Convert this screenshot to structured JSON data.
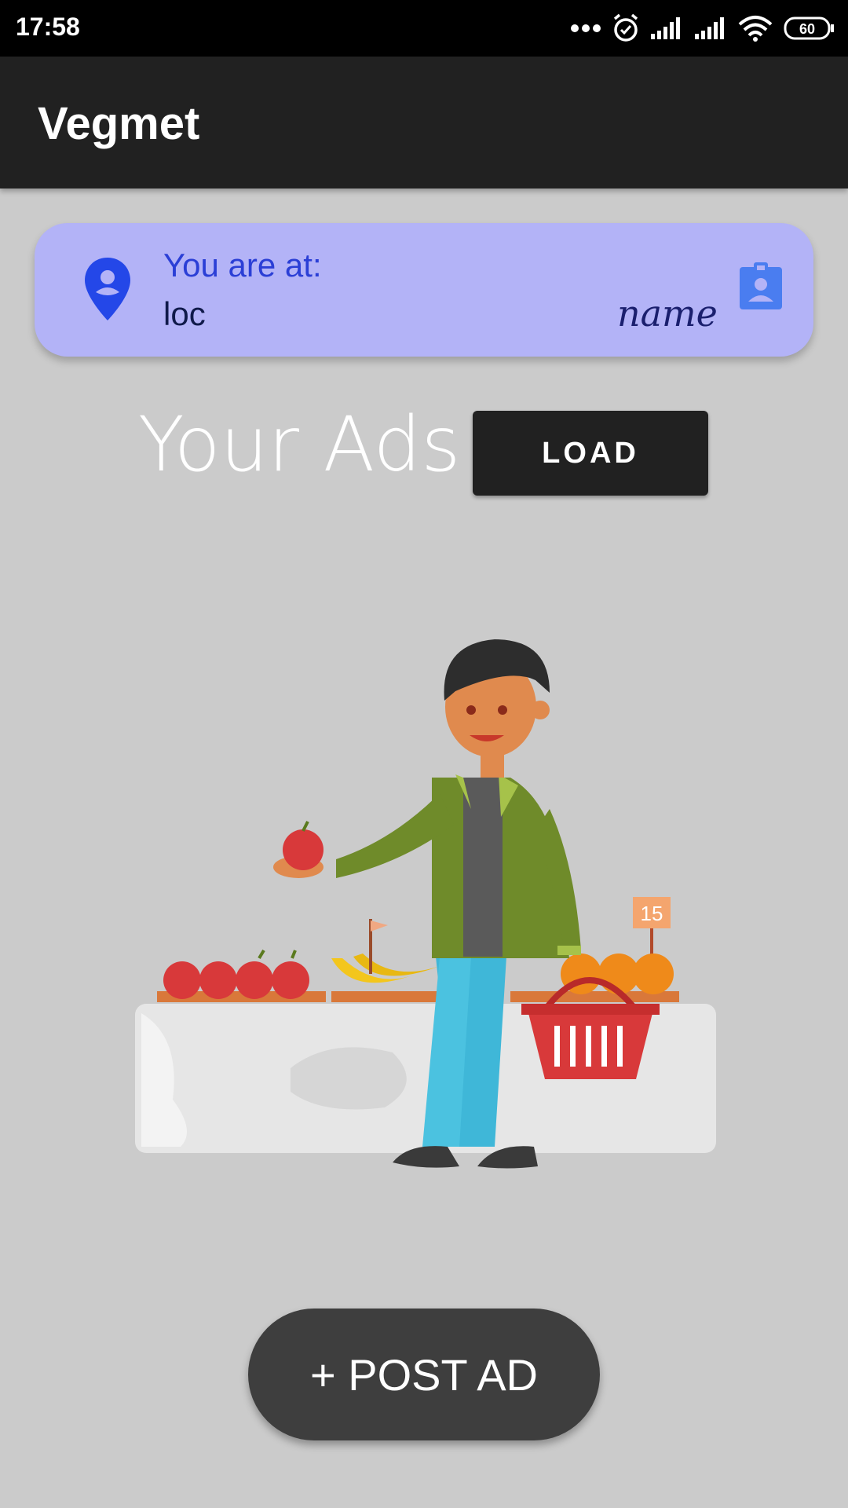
{
  "status_bar": {
    "time": "17:58",
    "battery": "60",
    "icons": [
      "more-dots-icon",
      "alarm-icon",
      "signal-icon",
      "signal-icon",
      "wifi-icon",
      "battery-icon"
    ]
  },
  "app_bar": {
    "title": "Vegmet"
  },
  "location_card": {
    "heading": "You are at:",
    "location": "loc",
    "name": "name",
    "colors": {
      "background": "#b3b3f7",
      "accent": "#2b3fd6"
    }
  },
  "ads": {
    "title": "Your Ads",
    "load_label": "LOAD"
  },
  "illustration": {
    "sign_number": "15",
    "icon": "shopper-illustration"
  },
  "post_ad": {
    "label": "+ POST AD"
  }
}
